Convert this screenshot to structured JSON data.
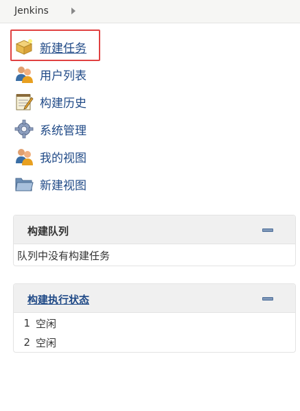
{
  "breadcrumb": {
    "root": "Jenkins"
  },
  "tasks": [
    {
      "label": "新建任务",
      "icon": "new-item-icon"
    },
    {
      "label": "用户列表",
      "icon": "people-icon"
    },
    {
      "label": "构建历史",
      "icon": "notepad-icon"
    },
    {
      "label": "系统管理",
      "icon": "gear-icon"
    },
    {
      "label": "我的视图",
      "icon": "user-icon"
    },
    {
      "label": "新建视图",
      "icon": "folder-icon"
    }
  ],
  "build_queue": {
    "title": "构建队列",
    "empty_text": "队列中没有构建任务"
  },
  "executors": {
    "title": "构建执行状态",
    "rows": [
      {
        "number": "1",
        "status": "空闲"
      },
      {
        "number": "2",
        "status": "空闲"
      }
    ]
  },
  "colors": {
    "link": "#204a87",
    "highlight": "#e04040",
    "pane_header": "#f0f0f0"
  }
}
